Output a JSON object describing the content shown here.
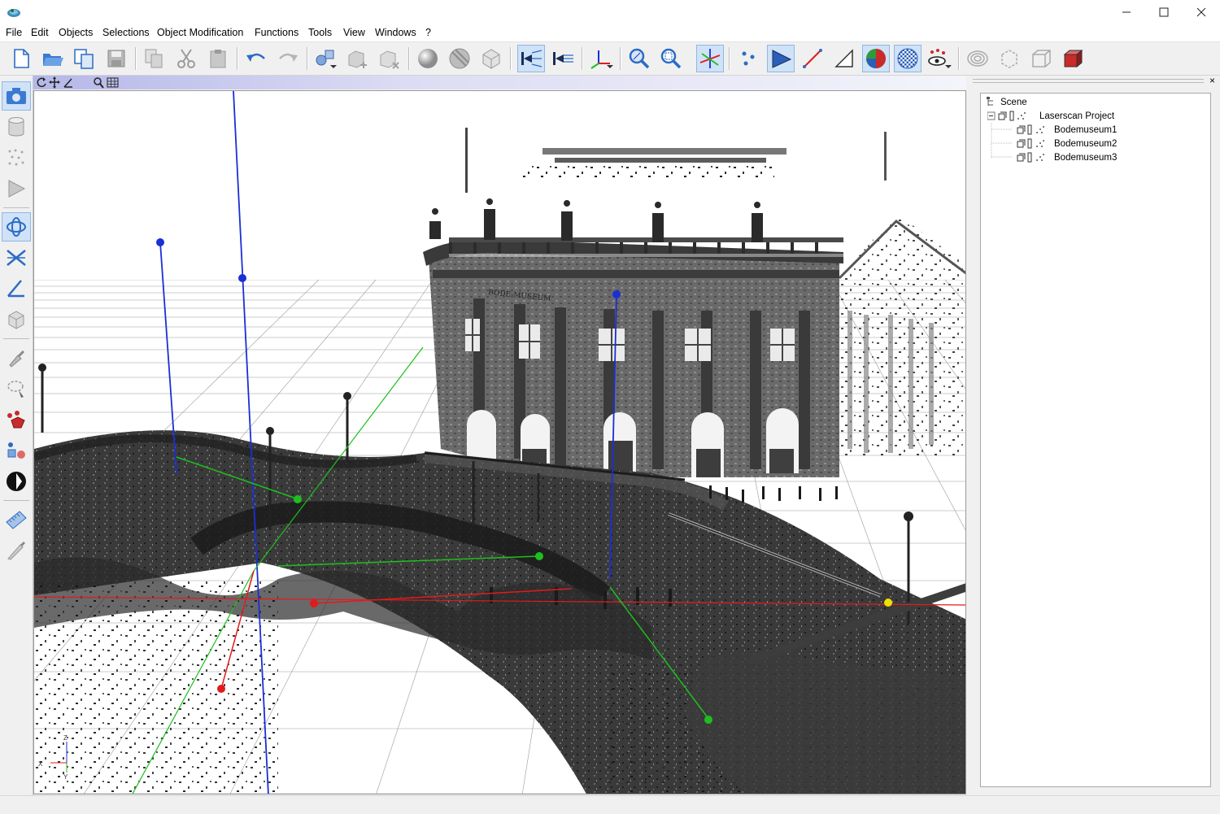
{
  "window": {
    "icon": "app-logo-icon",
    "controls": [
      "minimize-icon",
      "maximize-icon",
      "close-icon"
    ]
  },
  "menu": [
    "File",
    "Edit",
    "Objects",
    "Selections",
    "Object Modification",
    "Functions",
    "Tools",
    "View",
    "Windows",
    "?"
  ],
  "toolbar": {
    "icons": [
      "new-file-icon",
      "open-folder-icon",
      "copy-files-icon",
      "save-icon",
      "copy-icon",
      "cut-icon",
      "paste-icon",
      "undo-icon",
      "redo-icon",
      "add-object-icon",
      "add-box-icon",
      "delete-object-icon",
      "sphere-icon",
      "sphere-striped-icon",
      "box-grid-icon",
      "tb-mode-1-icon",
      "tb-mode-2-icon",
      "axis-tool-icon",
      "zoom-in-icon",
      "zoom-extent-icon",
      "axes-3d-icon",
      "points-icon",
      "triangle-filled-icon",
      "line-icon",
      "triangle-outline-icon",
      "color-sphere-icon",
      "texture-sphere-icon",
      "view-eye-icon",
      "target-icon",
      "dashed-box-icon",
      "wire-cube-icon",
      "solid-cube-icon"
    ],
    "active": [
      "tb-mode-1-icon",
      "axes-3d-icon",
      "triangle-filled-icon",
      "color-sphere-icon",
      "texture-sphere-icon"
    ]
  },
  "left_toolbar": {
    "icons": [
      "camera-icon",
      "cylinder-icon",
      "point-cloud-icon",
      "triangle-icon",
      "orbit-icon",
      "pan-cross-icon",
      "angle-icon",
      "box-icon",
      "brush-icon",
      "lasso-icon",
      "shapes-icon",
      "shapes-blue-icon",
      "contrast-icon",
      "ruler-icon",
      "knife-icon"
    ],
    "active": [
      "camera-icon",
      "orbit-icon"
    ]
  },
  "viewport": {
    "header_icons": [
      "rotate-icon",
      "move-icon",
      "angle-small-icon",
      "zoom-small-icon",
      "grid-small-icon"
    ],
    "axes_labels": {
      "x": "X",
      "y": "Y",
      "z": "Z"
    },
    "sign_text": "BODE-MUSEUM"
  },
  "scene_panel": {
    "close_label": "×",
    "tree": [
      {
        "label": "Scene",
        "level": 0
      },
      {
        "label": "Laserscan Project",
        "level": 1
      },
      {
        "label": "Bodemuseum1",
        "level": 2
      },
      {
        "label": "Bodemuseum2",
        "level": 2
      },
      {
        "label": "Bodemuseum3",
        "level": 2
      }
    ]
  },
  "colors": {
    "accent": "#1e73d0",
    "axis_x": "#e21b1b",
    "axis_y": "#1dbf1d",
    "axis_z": "#1b2fd6",
    "marker_yellow": "#f2e000"
  }
}
